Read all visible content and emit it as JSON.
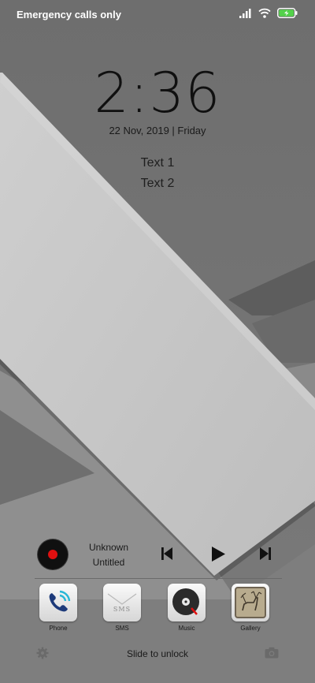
{
  "status_bar": {
    "carrier_text": "Emergency calls only"
  },
  "clock": {
    "time": "2:36",
    "date": "22 Nov, 2019 | Friday"
  },
  "widgets": {
    "text1": "Text 1",
    "text2": "Text 2"
  },
  "music": {
    "artist": "Unknown",
    "title": "Untitled"
  },
  "dock": {
    "items": [
      {
        "label": "Phone",
        "icon": "phone-icon"
      },
      {
        "label": "SMS",
        "icon": "sms-icon",
        "icon_text": "SMS"
      },
      {
        "label": "Music",
        "icon": "music-icon"
      },
      {
        "label": "Gallery",
        "icon": "gallery-icon"
      }
    ]
  },
  "bottom": {
    "unlock_text": "Slide to unlock"
  },
  "colors": {
    "background": "#7b7b7b",
    "band": "#c6c6c6",
    "text": "#1a1a1a",
    "battery": "#53d14a",
    "record": "#e01010"
  }
}
